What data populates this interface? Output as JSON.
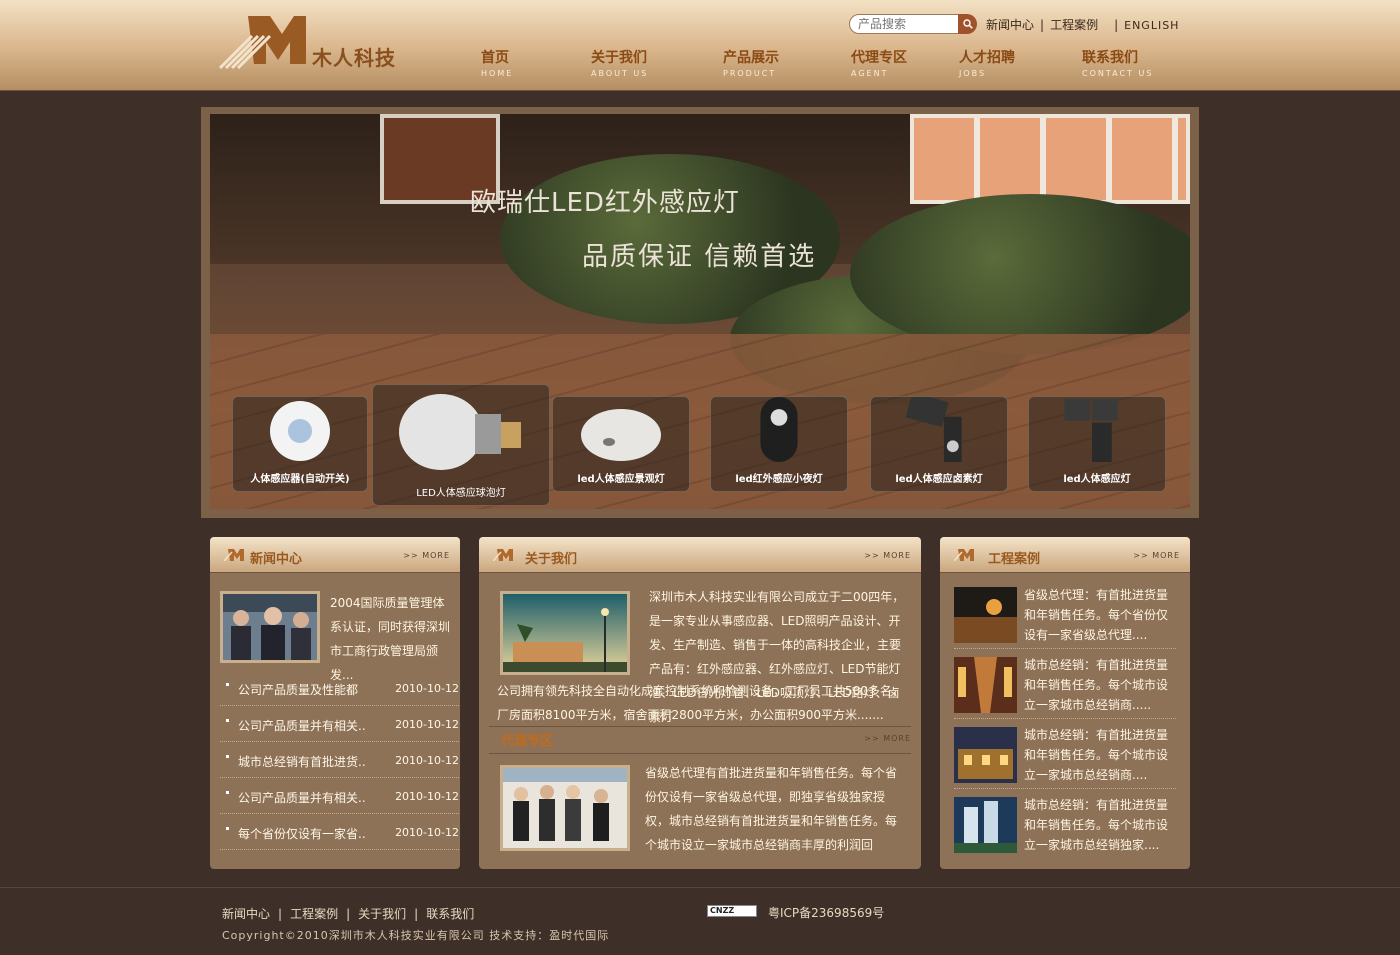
{
  "brand": {
    "name": "木人科技"
  },
  "search": {
    "placeholder": "产品搜索"
  },
  "toplinks": [
    "新闻中心",
    "工程案例",
    "ENGLISH"
  ],
  "nav": [
    {
      "cn": "首页",
      "en": "HOME"
    },
    {
      "cn": "关于我们",
      "en": "ABOUT US"
    },
    {
      "cn": "产品展示",
      "en": "PRODUCT"
    },
    {
      "cn": "代理专区",
      "en": "AGENT"
    },
    {
      "cn": "人才招聘",
      "en": "JOBS"
    },
    {
      "cn": "联系我们",
      "en": "CONTACT US"
    }
  ],
  "banner": {
    "title": "欧瑞仕LED红外感应灯",
    "subtitle": "品质保证  信赖首选",
    "products": [
      "人体感应器(自动开关)",
      "LED人体感应球泡灯",
      "led人体感应景观灯",
      "led红外感应小夜灯",
      "led人体感应卤素灯",
      "led人体感应灯"
    ]
  },
  "news": {
    "title": "新闻中心",
    "more": "MORE",
    "feature": "2004国际质量管理体系认证，同时获得深圳市工商行政管理局颁发...",
    "items": [
      {
        "title": "公司产品质量及性能都",
        "date": "2010-10-12"
      },
      {
        "title": "公司产品质量并有相关..",
        "date": "2010-10-12"
      },
      {
        "title": "城市总经销有首批进货..",
        "date": "2010-10-12"
      },
      {
        "title": "公司产品质量并有相关..",
        "date": "2010-10-12"
      },
      {
        "title": "每个省份仅设有一家省..",
        "date": "2010-10-12"
      }
    ]
  },
  "about": {
    "title": "关于我们",
    "more": "MORE",
    "text_top": "深圳市木人科技实业有限公司成立于二00四年，是一家专业从事感应器、LED照明产品设计、开发、生产制造、销售于一体的高科技企业，主要产品有：红外感应器、红外感应灯、LED节能灯泡、LED日光灯管、LED吸顶灯、LED路灯、卤素灯",
    "text_bottom": "公司拥有领先科技全自动化成套控制系统和检测设备，工厂员工共500多名，厂房面积8100平方米，宿舍面积2800平方米，办公面积900平方米.......",
    "agent_title": "代理专区",
    "agent_more": "MORE",
    "agent_text": "省级总代理有首批进货量和年销售任务。每个省份仅设有一家省级总代理，即独享省级独家授权，城市总经销有首批进货量和年销售任务。每个城市设立一家城市总经销商丰厚的利润回"
  },
  "cases": {
    "title": "工程案例",
    "more": "MORE",
    "items": [
      "省级总代理：有首批进货量和年销售任务。每个省份仅设有一家省级总代理....",
      "城市总经销：有首批进货量和年销售任务。每个城市设立一家城市总经销商.....",
      "城市总经销：有首批进货量和年销售任务。每个城市设立一家城市总经销商....",
      "城市总经销：有首批进货量和年销售任务。每个城市设立一家城市总经销独家...."
    ]
  },
  "footer": {
    "links": [
      "新闻中心",
      "工程案例",
      "关于我们",
      "联系我们"
    ],
    "cnzz": "CNZZ",
    "icp": "粤ICP备23698569号",
    "copyright": "Copyright©2010深圳市木人科技实业有限公司 技术支持：盈时代国际"
  }
}
